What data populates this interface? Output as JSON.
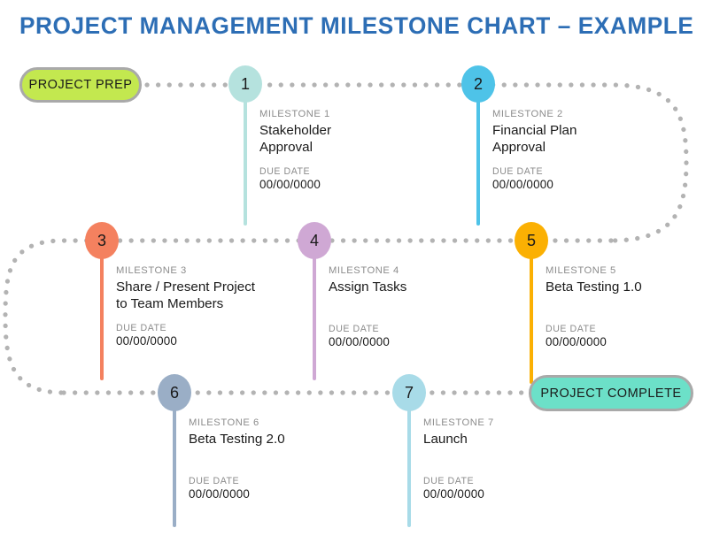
{
  "title": "PROJECT MANAGEMENT MILESTONE CHART  –  EXAMPLE",
  "title_color": "#2d6eb5",
  "terminals": {
    "start": {
      "label": "PROJECT PREP",
      "color": "#c3e84f",
      "border": "#a9a9a9"
    },
    "end": {
      "label": "PROJECT COMPLETE",
      "color": "#6ce0c8",
      "border": "#a9a9a9"
    }
  },
  "connector": {
    "color": "#b3b3b3",
    "style": "dotted"
  },
  "labels": {
    "due_date": "DUE DATE"
  },
  "milestones": [
    {
      "number": "1",
      "label": "MILESTONE 1",
      "name": "Stakeholder\nApproval",
      "name_line1": "Stakeholder",
      "name_line2": "Approval",
      "due_label": "DUE DATE",
      "due_date": "00/00/0000",
      "color": "#b5e2de"
    },
    {
      "number": "2",
      "label": "MILESTONE 2",
      "name": "Financial Plan\nApproval",
      "name_line1": "Financial Plan",
      "name_line2": "Approval",
      "due_label": "DUE DATE",
      "due_date": "00/00/0000",
      "color": "#4ec3e8"
    },
    {
      "number": "3",
      "label": "MILESTONE 3",
      "name": "Share / Present Project\nto Team Members",
      "name_line1": "Share / Present  Project",
      "name_line2": "to Team Members",
      "due_label": "DUE DATE",
      "due_date": "00/00/0000",
      "color": "#f4815f"
    },
    {
      "number": "4",
      "label": "MILESTONE 4",
      "name": "Assign Tasks",
      "name_line1": "Assign Tasks",
      "name_line2": "",
      "due_label": "DUE DATE",
      "due_date": "00/00/0000",
      "color": "#cfa8d4"
    },
    {
      "number": "5",
      "label": "MILESTONE 5",
      "name": "Beta Testing 1.0",
      "name_line1": "Beta Testing 1.0",
      "name_line2": "",
      "due_label": "DUE DATE",
      "due_date": "00/00/0000",
      "color": "#fbb003"
    },
    {
      "number": "6",
      "label": "MILESTONE 6",
      "name": "Beta Testing 2.0",
      "name_line1": "Beta Testing 2.0",
      "name_line2": "",
      "due_label": "DUE DATE",
      "due_date": "00/00/0000",
      "color": "#9aaec6"
    },
    {
      "number": "7",
      "label": "MILESTONE 7",
      "name": "Launch",
      "name_line1": "Launch",
      "name_line2": "",
      "due_label": "DUE DATE",
      "due_date": "00/00/0000",
      "color": "#a8dbe8"
    }
  ],
  "chart_data": {
    "type": "timeline",
    "title": "PROJECT MANAGEMENT MILESTONE CHART  –  EXAMPLE",
    "start_node": "PROJECT PREP",
    "end_node": "PROJECT COMPLETE",
    "rows": 3,
    "row_assignments": [
      {
        "row": 1,
        "nodes": [
          "PROJECT PREP",
          "1",
          "2"
        ]
      },
      {
        "row": 2,
        "nodes": [
          "3",
          "4",
          "5"
        ]
      },
      {
        "row": 3,
        "nodes": [
          "6",
          "7",
          "PROJECT COMPLETE"
        ]
      }
    ],
    "sequence": [
      "PROJECT PREP",
      "MILESTONE 1 – Stakeholder Approval – 00/00/0000",
      "MILESTONE 2 – Financial Plan Approval – 00/00/0000",
      "MILESTONE 3 – Share / Present Project to Team Members – 00/00/0000",
      "MILESTONE 4 – Assign Tasks – 00/00/0000",
      "MILESTONE 5 – Beta Testing 1.0 – 00/00/0000",
      "MILESTONE 6 – Beta Testing 2.0 – 00/00/0000",
      "MILESTONE 7 – Launch – 00/00/0000",
      "PROJECT COMPLETE"
    ],
    "node_colors": {
      "PROJECT PREP": "#c3e84f",
      "1": "#b5e2de",
      "2": "#4ec3e8",
      "3": "#f4815f",
      "4": "#cfa8d4",
      "5": "#fbb003",
      "6": "#9aaec6",
      "7": "#a8dbe8",
      "PROJECT COMPLETE": "#6ce0c8"
    }
  }
}
